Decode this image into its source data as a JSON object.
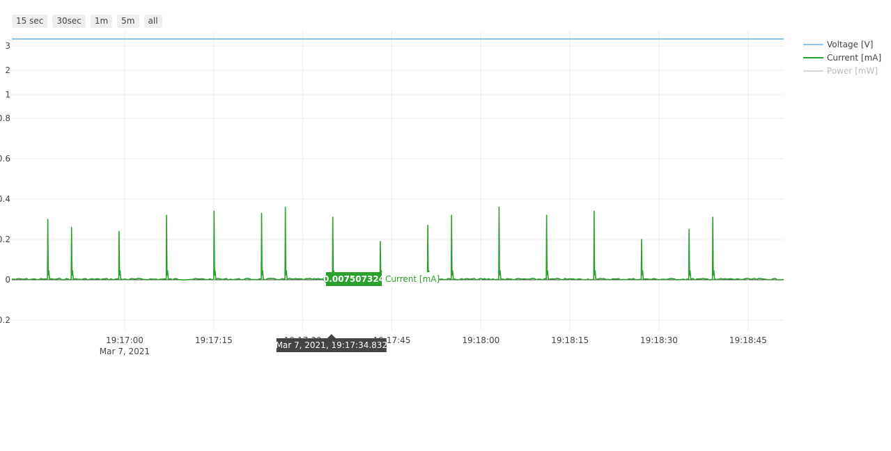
{
  "range_buttons": [
    "15 sec",
    "30sec",
    "1m",
    "5m",
    "all"
  ],
  "chart_data": {
    "type": "line",
    "title": "",
    "xlabel": "",
    "ylabel": "",
    "x_range": [
      "19:16:41",
      "19:18:51"
    ],
    "x_ticks": [
      "19:17:00",
      "19:17:15",
      "19:17:30",
      "19:17:45",
      "19:18:00",
      "19:18:15",
      "19:18:30",
      "19:18:45"
    ],
    "x_date_label": "Mar 7, 2021",
    "y_tick_labels": [
      "3",
      "2",
      "1",
      "0.8",
      "0.6",
      "0.4",
      "0.2",
      "0",
      "-0.2"
    ],
    "grid": true,
    "legend_position": "top-right",
    "series": [
      {
        "name": "Voltage [V]",
        "color": "#8ec6ec",
        "visible": true,
        "constant": 3.3
      },
      {
        "name": "Current [mA]",
        "color": "#2ca02c",
        "visible": true,
        "baseline": 0.003,
        "peaks": [
          {
            "t": "19:16:47.0",
            "v": 0.3
          },
          {
            "t": "19:16:51.0",
            "v": 0.26
          },
          {
            "t": "19:16:59.0",
            "v": 0.24
          },
          {
            "t": "19:17:07.0",
            "v": 0.32
          },
          {
            "t": "19:17:15.0",
            "v": 0.34
          },
          {
            "t": "19:17:23.0",
            "v": 0.33
          },
          {
            "t": "19:17:27.0",
            "v": 0.36
          },
          {
            "t": "19:17:35.0",
            "v": 0.31
          },
          {
            "t": "19:17:43.0",
            "v": 0.19
          },
          {
            "t": "19:17:51.0",
            "v": 0.27
          },
          {
            "t": "19:17:55.0",
            "v": 0.32
          },
          {
            "t": "19:18:03.0",
            "v": 0.36
          },
          {
            "t": "19:18:11.0",
            "v": 0.32
          },
          {
            "t": "19:18:19.0",
            "v": 0.34
          },
          {
            "t": "19:18:27.0",
            "v": 0.2
          },
          {
            "t": "19:18:35.0",
            "v": 0.25
          },
          {
            "t": "19:18:39.0",
            "v": 0.31
          }
        ],
        "plateaus": [
          {
            "start": "19:16:51.0",
            "end": "19:16:53.0",
            "v": 0.055
          },
          {
            "start": "19:16:59.0",
            "end": "19:16:59.8",
            "v": 0.055
          }
        ]
      },
      {
        "name": "Power [mW]",
        "color": "#d8d8d8",
        "visible": false
      }
    ],
    "hover": {
      "x_label": "Mar 7, 2021, 19:17:34.832",
      "value": "0.007507324",
      "series": "Current [mA]"
    }
  }
}
